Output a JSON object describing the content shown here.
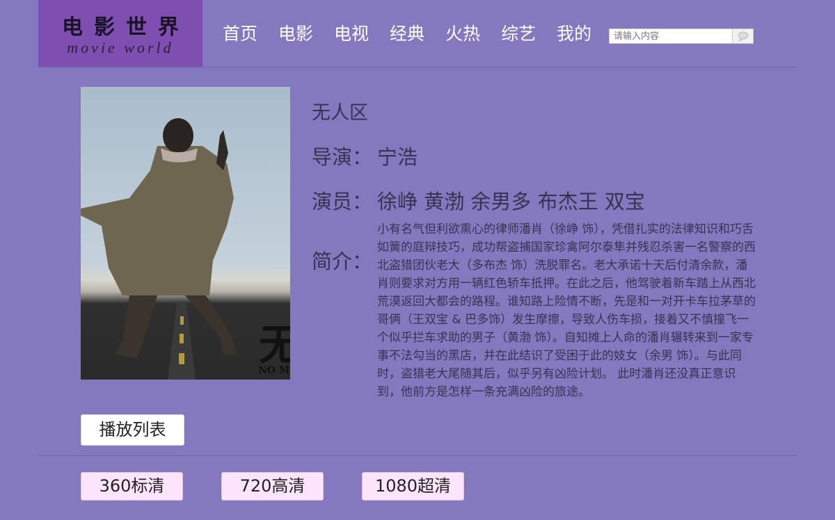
{
  "logo": {
    "cn": "电影世界",
    "en": "movie world"
  },
  "nav": [
    "首页",
    "电影",
    "电视",
    "经典",
    "火热",
    "综艺",
    "我的"
  ],
  "search": {
    "placeholder": "请输入内容",
    "icon": "search-icon"
  },
  "movie": {
    "title": "无人区",
    "director_label": "导演：",
    "director": "宁浩",
    "actors_label": "演员：",
    "actors": "徐峥 黄渤 余男多 布杰王 双宝",
    "intro_label": "简介：",
    "intro": "小有名气但利欲熏心的律师潘肖（徐峥 饰），凭借扎实的法律知识和巧舌如簧的庭辩技巧，成功帮盗捕国家珍禽阿尔泰隼并残忍杀害一名警察的西北盗猎团伙老大（多布杰 饰）洗脱罪名。老大承诺十天后付清余款，潘肖则要求对方用一辆红色轿车抵押。在此之后，他驾驶着新车踏上从西北荒漠返回大都会的路程。谁知路上险情不断，先是和一对开卡车拉茅草的哥俩（王双宝 & 巴多饰）发生摩擦，导致人伤车损，接着又不慎撞飞一个似乎拦车求助的男子（黄渤 饰）。自知摊上人命的潘肖辗转来到一家专事不法勾当的黑店，并在此结识了受困于此的妓女（余男 饰）。与此同时，盗猎老大尾随其后，似乎另有凶险计划。 此时潘肖还没真正意识到，他前方是怎样一条充满凶险的旅途。",
    "poster_text": "无",
    "poster_text_en": "NO M"
  },
  "playlist_button": "播放列表",
  "qualities": [
    "360标清",
    "720高清",
    "1080超清"
  ]
}
